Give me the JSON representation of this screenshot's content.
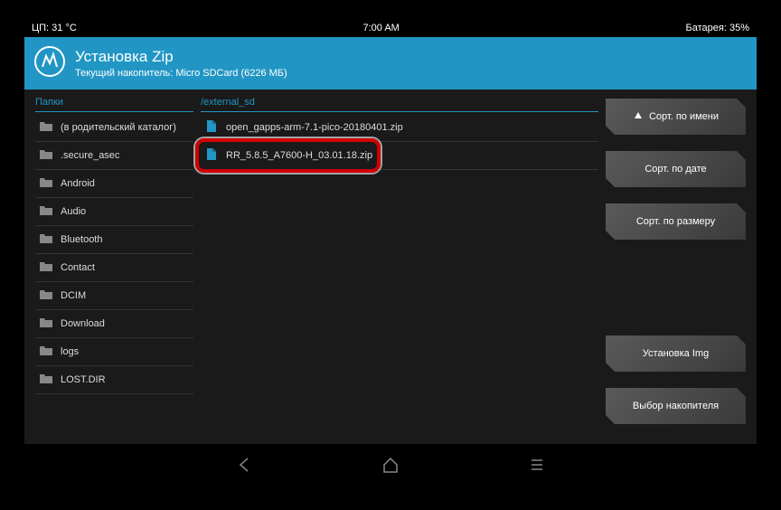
{
  "statusbar": {
    "left": "ЦП: 31 °C",
    "center": "7:00 AM",
    "right": "Батарея: 35%"
  },
  "header": {
    "title": "Установка Zip",
    "subtitle": "Текущий накопитель: Micro SDCard (6226 МБ)"
  },
  "labels": {
    "folders": "Папки",
    "path": "/external_sd"
  },
  "folders": [
    "(в родительский каталог)",
    ".secure_asec",
    "Android",
    "Audio",
    "Bluetooth",
    "Contact",
    "DCIM",
    "Download",
    "logs",
    "LOST.DIR"
  ],
  "files": [
    {
      "name": "open_gapps-arm-7.1-pico-20180401.zip",
      "highlighted": false
    },
    {
      "name": "RR_5.8.5_A7600-H_03.01.18.zip",
      "highlighted": true
    }
  ],
  "buttons": {
    "sort_name": "Сорт. по имени",
    "sort_date": "Сорт. по дате",
    "sort_size": "Сорт. по размеру",
    "install_img": "Установка Img",
    "select_storage": "Выбор накопителя"
  }
}
